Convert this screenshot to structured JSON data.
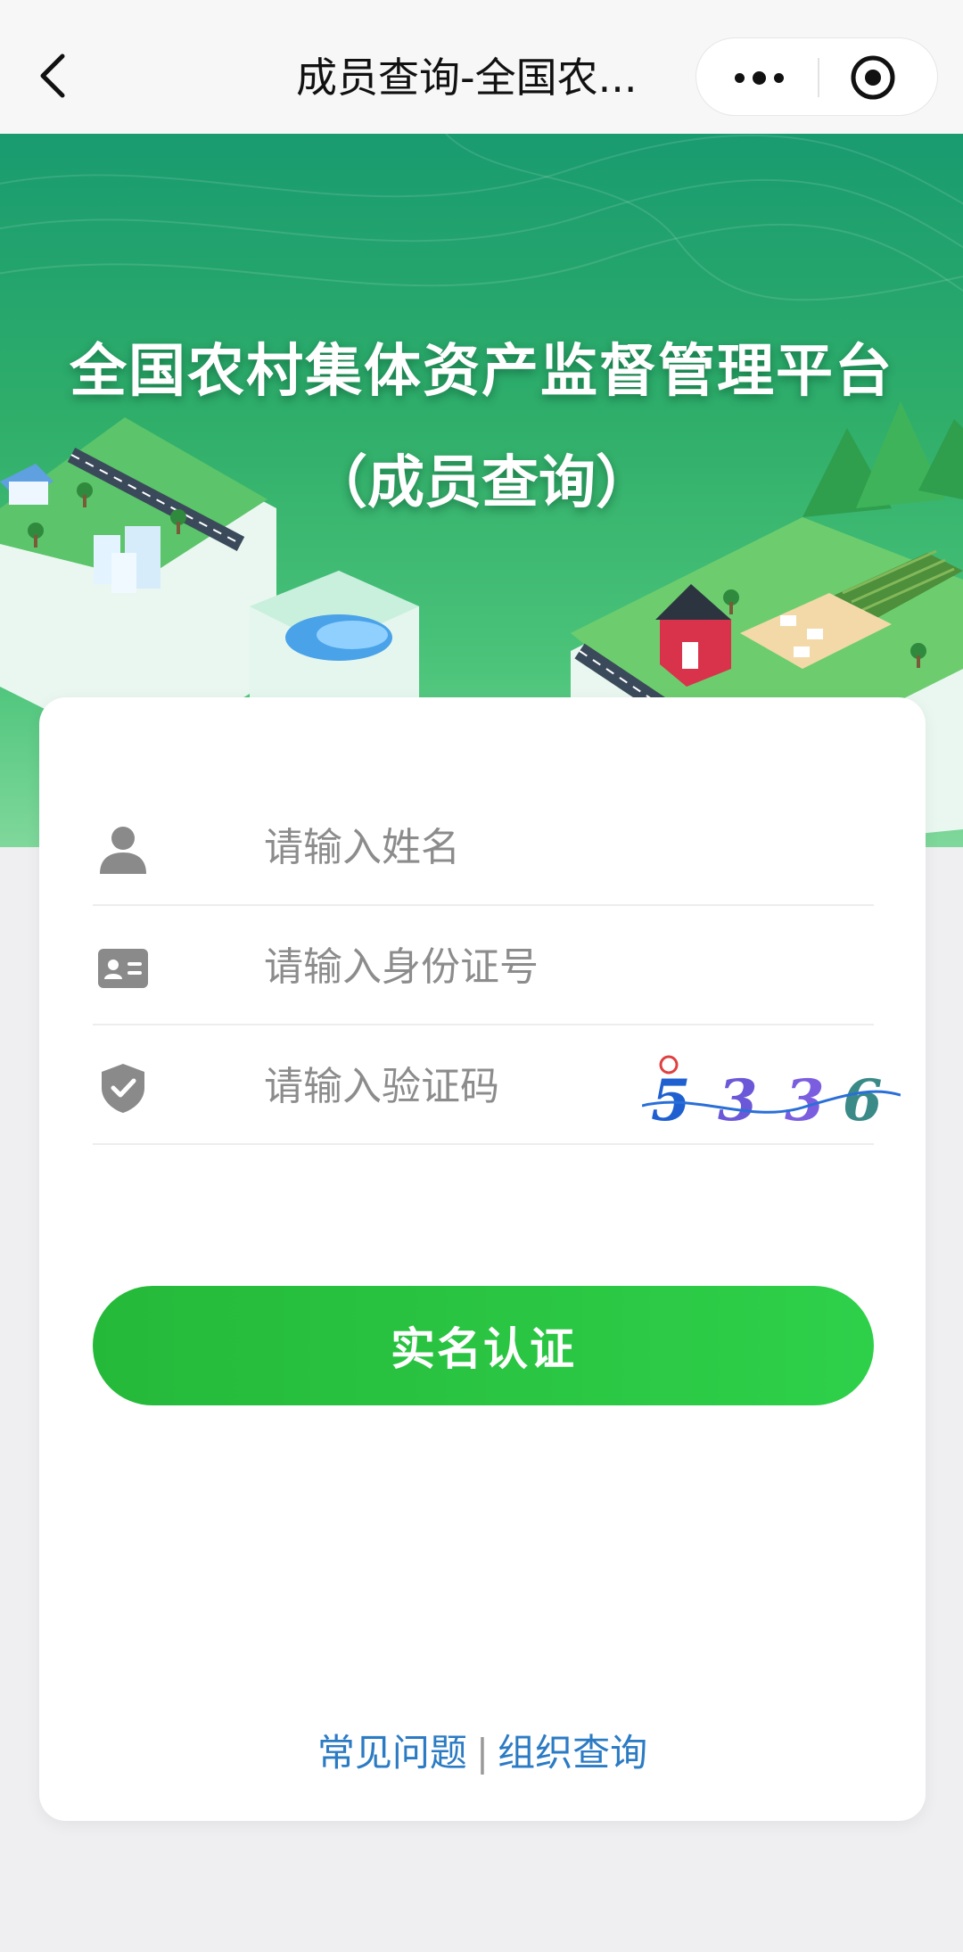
{
  "navbar": {
    "title": "成员查询-全国农...",
    "back_icon": "chevron-left-icon",
    "more_icon": "more-dots-icon",
    "close_icon": "target-circle-icon"
  },
  "hero": {
    "title": "全国农村集体资产监督管理平台",
    "subtitle": "（成员查询）"
  },
  "form": {
    "name_placeholder": "请输入姓名",
    "id_placeholder": "请输入身份证号",
    "captcha_placeholder": "请输入验证码",
    "captcha_code": "5336",
    "submit_label": "实名认证"
  },
  "footer_links": {
    "faq": "常见问题",
    "separator": "|",
    "org_query": "组织查询"
  },
  "colors": {
    "primary_button": "#2ed04a",
    "link": "#2b7bc4",
    "hero_top": "#199b70"
  }
}
